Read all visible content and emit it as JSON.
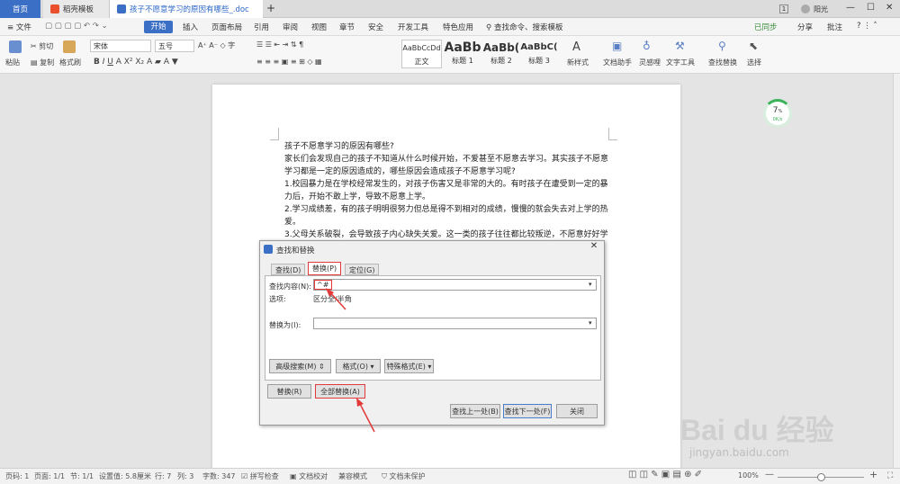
{
  "tabs": {
    "home": "首页",
    "template": "稻壳模板",
    "doc": "孩子不愿意学习的原因有哪些_.doc",
    "add": "+",
    "page_badge": "1",
    "user": "阳光"
  },
  "menu": {
    "file": "文件",
    "items": [
      "开始",
      "插入",
      "页面布局",
      "引用",
      "审阅",
      "视图",
      "章节",
      "安全",
      "开发工具",
      "特色应用"
    ],
    "search": "查找命令、搜索模板",
    "sync": "已同步",
    "share": "分享",
    "annotate": "批注"
  },
  "toolbar": {
    "paste": "粘贴",
    "cut": "剪切",
    "copy": "复制",
    "format_painter": "格式刷",
    "font": "宋体",
    "size": "五号",
    "styles": [
      {
        "sample": "AaBbCcDd",
        "name": "正文"
      },
      {
        "sample": "AaBb",
        "name": "标题 1"
      },
      {
        "sample": "AaBb(",
        "name": "标题 2"
      },
      {
        "sample": "AaBbC(",
        "name": "标题 3"
      }
    ],
    "new_style": "新样式",
    "doc_helper": "文档助手",
    "inspiration": "灵感哩",
    "text_tools": "文字工具",
    "find_replace": "查找替换",
    "select": "选择"
  },
  "document": {
    "lines": [
      "孩子不愿意学习的原因有哪些?",
      "家长们会发现自己的孩子不知道从什么时候开始，不爱甚至不愿意去学习。其实孩子不愿意",
      "学习都是一定的原因造成的，哪些原因会造成孩子不愿意学习呢?",
      "1.校园暴力是在学校经常发生的，对孩子伤害又是非常的大的。有时孩子在遭受到一定的暴",
      "力后，开始不敢上学，导致不愿意上学。",
      "2.学习成绩差，有的孩子明明很努力但总是得不到相对的成绩，慢慢的就会失去对上学的热",
      "爱。",
      "3.父母关系破裂，会导致孩子内心缺失关爱。这一类的孩子往往都比较叛逆，不愿意好好学"
    ]
  },
  "progress": {
    "value": "7",
    "unit": "%",
    "sub": "0K/s"
  },
  "dialog": {
    "title": "查找和替换",
    "tab_find": "查找(D)",
    "tab_replace": "替换(P)",
    "tab_goto": "定位(G)",
    "find_label": "查找内容(N):",
    "find_value": "^#",
    "options_label": "选项:",
    "options_value": "区分全/半角",
    "replace_label": "替换为(I):",
    "replace_value": "",
    "adv_search": "高级搜索(M)",
    "format": "格式(O)",
    "special": "特殊格式(E)",
    "replace_btn": "替换(R)",
    "replace_all": "全部替换(A)",
    "find_prev": "查找上一处(B)",
    "find_next": "查找下一处(F)",
    "close": "关闭"
  },
  "status": {
    "page_no": "页码: 1",
    "pages": "页面: 1/1",
    "section": "节: 1/1",
    "setting": "设置值: 5.8厘米",
    "row": "行: 7",
    "col": "列: 3",
    "words": "字数: 347",
    "spell": "拼写检查",
    "proof": "文档校对",
    "compat": "兼容模式",
    "unprotected": "文档未保护",
    "zoom": "100%"
  },
  "watermark": {
    "brand": "Bai du 经验",
    "url": "jingyan.baidu.com"
  }
}
